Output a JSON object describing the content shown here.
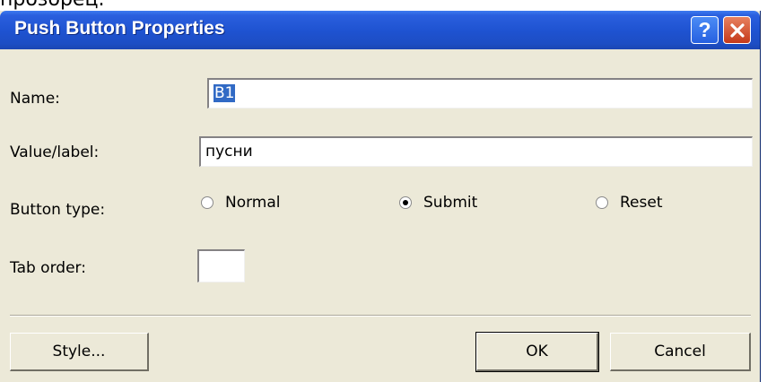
{
  "above_text": "прозорец.",
  "dialog": {
    "title": "Push Button Properties",
    "help_glyph": "?",
    "help_icon": "help-icon",
    "close_icon": "close-icon",
    "colors": {
      "titlebar": "#2058d8",
      "face": "#ece9d8",
      "selection": "#316ac5"
    }
  },
  "form": {
    "name_label": "Name:",
    "name_value": "B1",
    "value_label": "Value/label:",
    "value_value": "пусни",
    "button_type_label": "Button type:",
    "button_types": [
      {
        "label": "Normal",
        "checked": false
      },
      {
        "label": "Submit",
        "checked": true
      },
      {
        "label": "Reset",
        "checked": false
      }
    ],
    "tab_order_label": "Tab order:",
    "tab_order_value": ""
  },
  "buttons": {
    "style": "Style...",
    "ok": "OK",
    "cancel": "Cancel"
  }
}
